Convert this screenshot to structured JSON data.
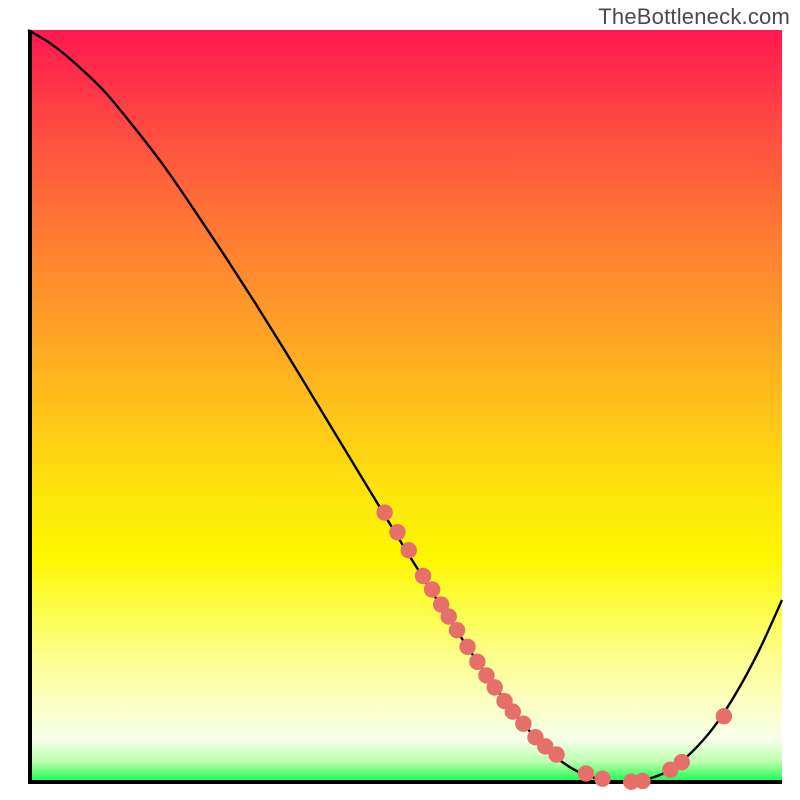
{
  "attribution": "TheBottleneck.com",
  "colors": {
    "axis": "#000000",
    "curve": "#000000",
    "dot_fill": "#e76f6a",
    "dot_stroke": "#c9534f",
    "bg_top": "#ff1850",
    "bg_bottom": "#00ff46"
  },
  "chart_data": {
    "type": "line",
    "title": "",
    "xlabel": "",
    "ylabel": "",
    "xlim": [
      0,
      100
    ],
    "ylim": [
      0,
      100
    ],
    "grid": false,
    "legend": false,
    "series": [
      {
        "name": "bottleneck-curve",
        "x": [
          0,
          3,
          6,
          10,
          14,
          18,
          22,
          26,
          30,
          34,
          38,
          42,
          46,
          50,
          54,
          58,
          62,
          66,
          70,
          73,
          76,
          79,
          82,
          85,
          88,
          91,
          94,
          97,
          100
        ],
        "y": [
          100,
          98.2,
          95.8,
          92.0,
          87.2,
          82.0,
          76.2,
          70.2,
          64.0,
          57.6,
          51.0,
          44.4,
          37.8,
          31.2,
          24.8,
          18.6,
          12.8,
          7.6,
          3.6,
          1.6,
          0.6,
          0.2,
          0.6,
          1.8,
          4.2,
          7.6,
          12.2,
          17.8,
          24.4
        ]
      }
    ],
    "highlight_points": {
      "name": "highlight-dots",
      "coords": [
        [
          47.3,
          36.0
        ],
        [
          49.0,
          33.4
        ],
        [
          50.5,
          31.0
        ],
        [
          52.4,
          27.6
        ],
        [
          53.6,
          25.8
        ],
        [
          54.8,
          23.8
        ],
        [
          55.8,
          22.2
        ],
        [
          56.9,
          20.4
        ],
        [
          58.3,
          18.2
        ],
        [
          59.6,
          16.2
        ],
        [
          60.8,
          14.4
        ],
        [
          61.9,
          12.8
        ],
        [
          63.2,
          11.0
        ],
        [
          64.3,
          9.6
        ],
        [
          65.7,
          8.0
        ],
        [
          67.3,
          6.2
        ],
        [
          68.6,
          5.0
        ],
        [
          70.1,
          3.9
        ],
        [
          74.0,
          1.4
        ],
        [
          76.2,
          0.7
        ],
        [
          80.0,
          0.3
        ],
        [
          81.5,
          0.4
        ],
        [
          85.2,
          1.9
        ],
        [
          86.7,
          2.9
        ],
        [
          92.3,
          9.0
        ]
      ]
    }
  }
}
